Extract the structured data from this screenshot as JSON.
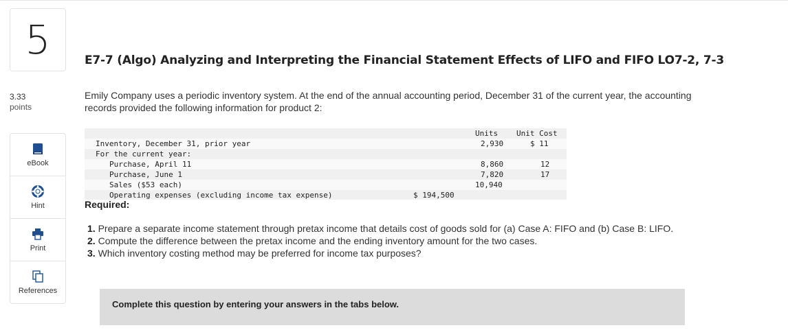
{
  "question": {
    "number": "5",
    "points_value": "3.33",
    "points_label": "points",
    "title": "E7-7 (Algo) Analyzing and Interpreting the Financial Statement Effects of LIFO and FIFO LO7-2, 7-3",
    "intro": "Emily Company uses a periodic inventory system. At the end of the annual accounting period, December 31 of the current year, the accounting records provided the following information for product 2:"
  },
  "tools": [
    {
      "label": "eBook",
      "icon": "book-icon"
    },
    {
      "label": "Hint",
      "icon": "lifebuoy-icon"
    },
    {
      "label": "Print",
      "icon": "printer-icon"
    },
    {
      "label": "References",
      "icon": "documents-icon"
    }
  ],
  "table": {
    "headers": {
      "units": "Units",
      "unit_cost": "Unit Cost"
    },
    "rows": [
      {
        "label": "Inventory, December 31, prior year",
        "units": "2,930",
        "cost": "$ 11",
        "amount": ""
      },
      {
        "label": "For the current year:",
        "units": "",
        "cost": "",
        "amount": ""
      },
      {
        "label": "Purchase, April 11",
        "units": "8,860",
        "cost": "12",
        "amount": ""
      },
      {
        "label": "Purchase, June 1",
        "units": "7,820",
        "cost": "17",
        "amount": ""
      },
      {
        "label": "Sales ($53 each)",
        "units": "10,940",
        "cost": "",
        "amount": ""
      },
      {
        "label": "Operating expenses (excluding income tax expense)",
        "units": "",
        "cost": "",
        "amount": "$ 194,500"
      }
    ]
  },
  "required": {
    "heading": "Required:",
    "items": [
      {
        "num": "1.",
        "text": "Prepare a separate income statement through pretax income that details cost of goods sold for (a) Case A: FIFO and (b) Case B: LIFO."
      },
      {
        "num": "2.",
        "text": "Compute the difference between the pretax income and the ending inventory amount for the two cases."
      },
      {
        "num": "3.",
        "text": "Which inventory costing method may be preferred for income tax purposes?"
      }
    ]
  },
  "banner": {
    "text": "Complete this question by entering your answers in the tabs below."
  }
}
